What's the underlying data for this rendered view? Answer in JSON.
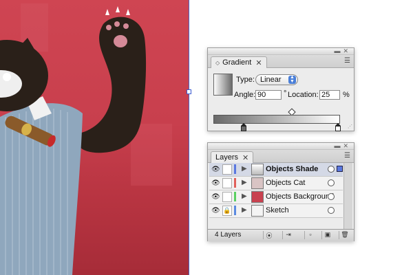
{
  "gradient_panel": {
    "tab_label": "Gradient",
    "type_label": "Type:",
    "type_value": "Linear",
    "angle_label": "Angle:",
    "angle_value": "90",
    "angle_unit": "°",
    "location_label": "Location:",
    "location_value": "25",
    "location_unit": "%"
  },
  "layers_panel": {
    "tab_label": "Layers",
    "layers": [
      {
        "name": "Objects Shade",
        "color": "#5a78e0",
        "selected": true,
        "locked": false
      },
      {
        "name": "Objects Cat",
        "color": "#e0605a",
        "selected": false,
        "locked": false
      },
      {
        "name": "Objects Background",
        "color": "#5ad060",
        "selected": false,
        "locked": false
      },
      {
        "name": "Sketch",
        "color": "#5a8ae0",
        "selected": false,
        "locked": true
      }
    ],
    "layer_count": "4 Layers"
  },
  "icons": {
    "visibility": "eye-icon",
    "lock": "lock-icon",
    "expand": "disclosure-triangle-icon",
    "panel_menu": "panel-menu-icon",
    "close": "close-icon"
  }
}
